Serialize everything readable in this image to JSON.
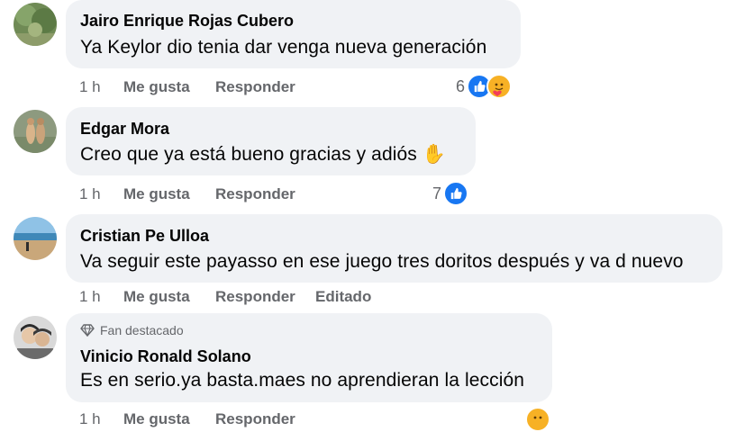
{
  "comments": [
    {
      "author": "Jairo Enrique Rojas Cubero",
      "text": "Ya Keylor dio tenia dar venga nueva generación",
      "time": "1 h",
      "like_label": "Me gusta",
      "reply_label": "Responder",
      "reaction_count": "6",
      "reactions": [
        "like-icon",
        "care-icon"
      ]
    },
    {
      "author": "Edgar Mora",
      "text": "Creo que ya está bueno gracias y adiós",
      "emoji": "✋",
      "time": "1 h",
      "like_label": "Me gusta",
      "reply_label": "Responder",
      "reaction_count": "7",
      "reactions": [
        "like-icon"
      ]
    },
    {
      "author": "Cristian Pe Ulloa",
      "text": "Va seguir este payasso en ese juego tres doritos después y va d nuevo",
      "time": "1 h",
      "like_label": "Me gusta",
      "reply_label": "Responder",
      "edited_label": "Editado"
    },
    {
      "badge": "Fan destacado",
      "badge_icon": "diamond-icon",
      "author": "Vinicio Ronald Solano",
      "text": "Es en serio.ya basta.maes no aprendieran la lección",
      "time": "1 h",
      "like_label": "Me gusta",
      "reply_label": "Responder"
    }
  ],
  "colors": {
    "bubble": "#f0f2f5",
    "secondary_text": "#65676b",
    "like_blue": "#1877f2",
    "care_yellow": "#f7b125"
  }
}
